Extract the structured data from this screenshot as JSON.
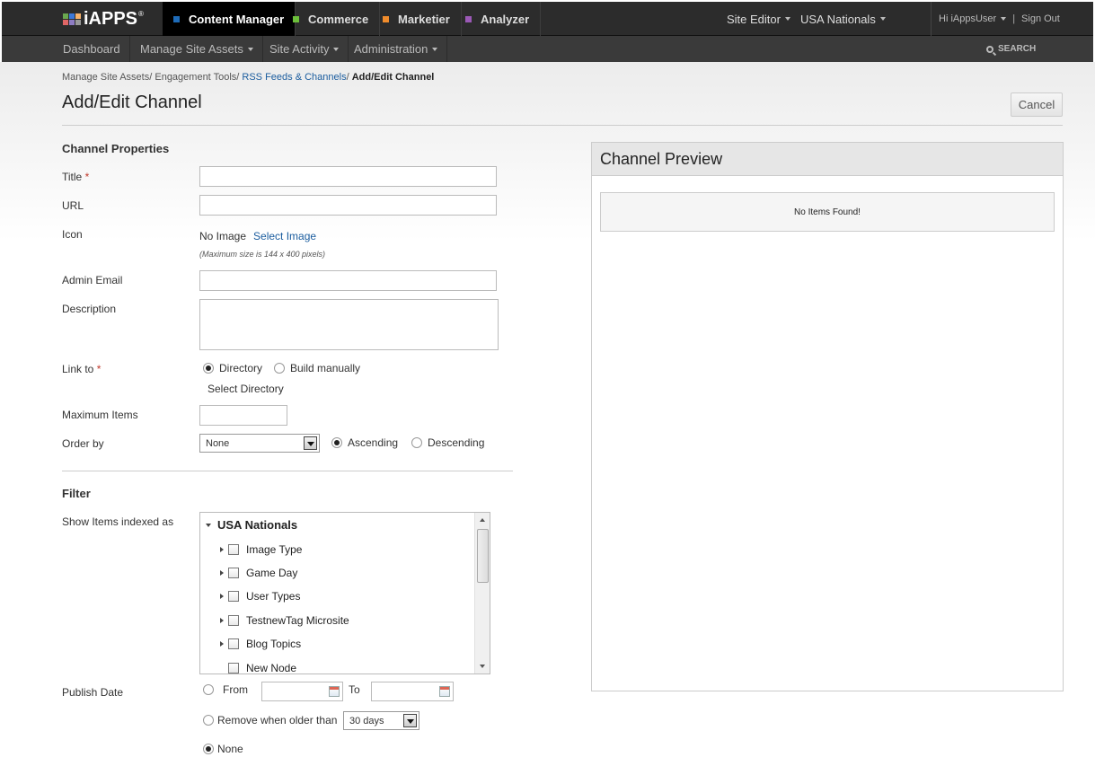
{
  "brand": {
    "name": "iAPPS",
    "reg": "®",
    "logo_colors": [
      "#6aa84f",
      "#3c78d8",
      "#f6b26b",
      "#e06666",
      "#8e7cc3",
      "#999999"
    ]
  },
  "apps": [
    {
      "label": "Content Manager",
      "color": "#1e6bb8",
      "active": true
    },
    {
      "label": "Commerce",
      "color": "#6cbf3a",
      "active": false
    },
    {
      "label": "Marketier",
      "color": "#f08c2c",
      "active": false
    },
    {
      "label": "Analyzer",
      "color": "#9b59b6",
      "active": false
    }
  ],
  "top_right": {
    "site_editor": "Site Editor",
    "site": "USA Nationals",
    "greeting": "Hi iAppsUser",
    "sign_out": "Sign Out"
  },
  "nav": {
    "items": [
      "Dashboard",
      "Manage Site Assets",
      "Site Activity",
      "Administration"
    ],
    "search": "SEARCH"
  },
  "breadcrumb": {
    "c1": "Manage Site Assets",
    "c2": "Engagement Tools",
    "c3": "RSS Feeds & Channels",
    "current": "Add/Edit Channel",
    "sep": "/"
  },
  "page": {
    "title": "Add/Edit Channel",
    "cancel": "Cancel"
  },
  "form": {
    "section": "Channel Properties",
    "title_label": "Title",
    "url_label": "URL",
    "icon_label": "Icon",
    "no_image": "No Image",
    "select_image": "Select Image",
    "image_hint": "(Maximum size is 144 x 400 pixels)",
    "admin_email_label": "Admin Email",
    "description_label": "Description",
    "link_to_label": "Link to",
    "link_directory": "Directory",
    "link_manual": "Build manually",
    "link_selected": "Directory",
    "select_directory": "Select Directory",
    "max_items_label": "Maximum Items",
    "order_by_label": "Order by",
    "order_by_value": "None",
    "ascending": "Ascending",
    "descending": "Descending",
    "order_selected": "Ascending",
    "required": "*"
  },
  "filter": {
    "section": "Filter",
    "show_items_label": "Show Items indexed as",
    "tree_root": "USA Nationals",
    "tree_items": [
      "Image Type",
      "Game Day",
      "User Types",
      "TestnewTag Microsite",
      "Blog Topics",
      "New Node"
    ],
    "publish_date_label": "Publish Date",
    "from": "From",
    "to": "To",
    "remove_older": "Remove when older than",
    "older_value": "30 days",
    "none": "None",
    "publish_selected": "None"
  },
  "preview": {
    "title": "Channel Preview",
    "empty": "No Items Found!"
  }
}
